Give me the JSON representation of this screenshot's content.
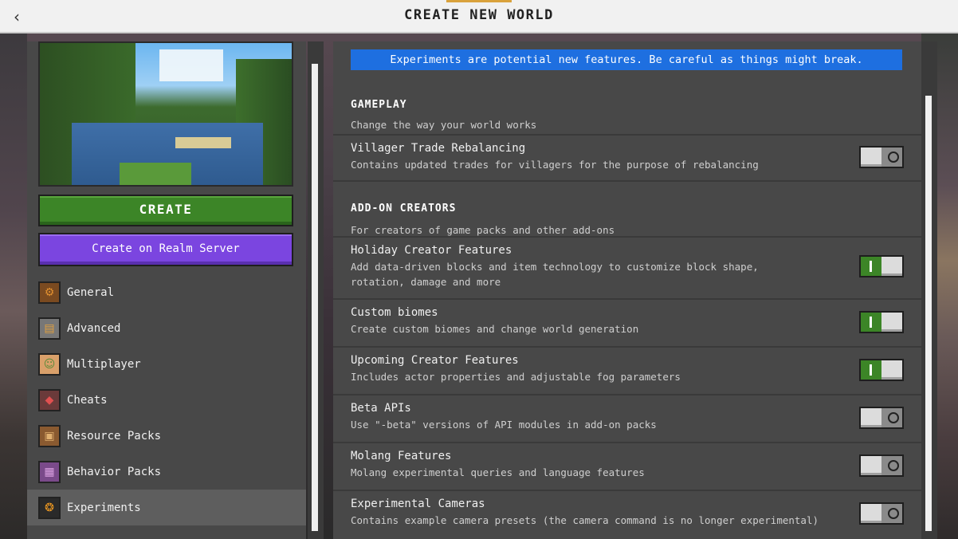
{
  "header": {
    "title": "CREATE NEW WORLD",
    "back_icon": "chevron-left-icon"
  },
  "left": {
    "create_label": "CREATE",
    "realm_label": "Create on Realm Server",
    "nav": [
      {
        "label": "General",
        "icon": "gear-icon"
      },
      {
        "label": "Advanced",
        "icon": "furnace-icon"
      },
      {
        "label": "Multiplayer",
        "icon": "players-icon"
      },
      {
        "label": "Cheats",
        "icon": "command-block-icon"
      },
      {
        "label": "Resource Packs",
        "icon": "chest-icon"
      },
      {
        "label": "Behavior Packs",
        "icon": "bundle-icon"
      },
      {
        "label": "Experiments",
        "icon": "experiments-icon",
        "active": true
      }
    ]
  },
  "right": {
    "banner": "Experiments are potential new features. Be careful as things might break.",
    "gameplay": {
      "heading": "GAMEPLAY",
      "desc": "Change the way your world works"
    },
    "addon": {
      "heading": "ADD-ON CREATORS",
      "desc": "For creators of game packs and other add-ons"
    },
    "rows": [
      {
        "title": "Villager Trade Rebalancing",
        "desc": "Contains updated trades for villagers for the purpose of rebalancing",
        "on": false
      },
      {
        "title": "Holiday Creator Features",
        "desc": "Add data-driven blocks and item technology to customize block shape, rotation, damage and more",
        "on": true
      },
      {
        "title": "Custom biomes",
        "desc": "Create custom biomes and change world generation",
        "on": true
      },
      {
        "title": "Upcoming Creator Features",
        "desc": "Includes actor properties and adjustable fog parameters",
        "on": true
      },
      {
        "title": "Beta APIs",
        "desc": "Use \"-beta\" versions of API modules in add-on packs",
        "on": false
      },
      {
        "title": "Molang Features",
        "desc": "Molang experimental queries and language features",
        "on": false
      },
      {
        "title": "Experimental Cameras",
        "desc": "Contains example camera presets (the camera command is no longer experimental)",
        "on": false
      }
    ]
  },
  "colors": {
    "create_green": "#3c8527",
    "realm_purple": "#7b45e0",
    "banner_blue": "#1e6fe0",
    "panel": "#484848"
  }
}
